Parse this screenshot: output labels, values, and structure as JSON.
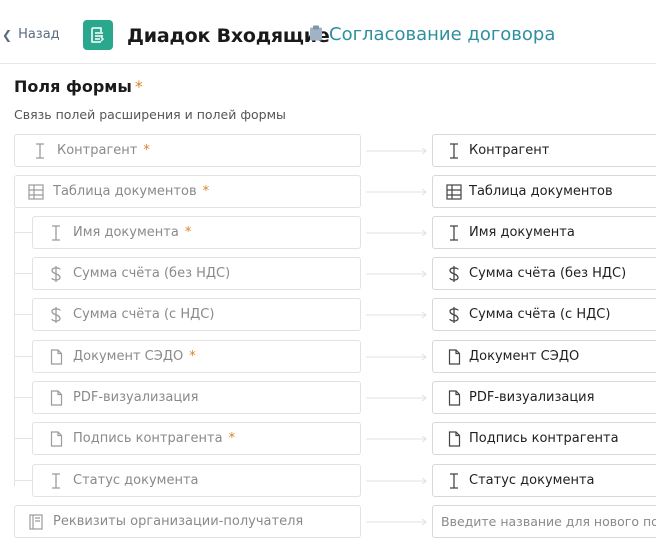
{
  "header": {
    "back_label": "Назад",
    "app_title": "Диадок Входящие",
    "process_title": "Согласование договора"
  },
  "section": {
    "title": "Поля формы",
    "required_mark": "*",
    "description": "Связь полей расширения и полей формы"
  },
  "mappings": [
    {
      "source": "Контрагент",
      "icon": "text-field-icon",
      "required": "*",
      "target": "Контрагент",
      "target_icon": "text-field-icon"
    },
    {
      "source": "Таблица документов",
      "icon": "table-icon",
      "required": "*",
      "target": "Таблица документов",
      "target_icon": "table-icon"
    },
    {
      "source": "Имя документа",
      "icon": "text-field-icon",
      "required": "*",
      "target": "Имя документа",
      "target_icon": "text-field-icon"
    },
    {
      "source": "Сумма счёта (без НДС)",
      "icon": "dollar-icon",
      "required": "",
      "target": "Сумма счёта (без НДС)",
      "target_icon": "dollar-icon"
    },
    {
      "source": "Сумма счёта (с НДС)",
      "icon": "dollar-icon",
      "required": "",
      "target": "Сумма счёта (с НДС)",
      "target_icon": "dollar-icon"
    },
    {
      "source": "Документ СЭДО",
      "icon": "file-icon",
      "required": "*",
      "target": "Документ СЭДО",
      "target_icon": "file-icon"
    },
    {
      "source": "PDF-визуализация",
      "icon": "file-icon",
      "required": "",
      "target": "PDF-визуализация",
      "target_icon": "file-icon"
    },
    {
      "source": "Подпись контрагента",
      "icon": "file-icon",
      "required": "*",
      "target": "Подпись контрагента",
      "target_icon": "file-icon"
    },
    {
      "source": "Статус документа",
      "icon": "text-field-icon",
      "required": "",
      "target": "Статус документа",
      "target_icon": "text-field-icon"
    },
    {
      "source": "Реквизиты организации-получателя",
      "icon": "record-icon",
      "required": "",
      "target_placeholder": "Введите название для нового поля"
    }
  ],
  "colors": {
    "accent": "#2aa88e",
    "process_link": "#2e8fa0",
    "required": "#d9822b",
    "border": "#e2e2e2"
  }
}
